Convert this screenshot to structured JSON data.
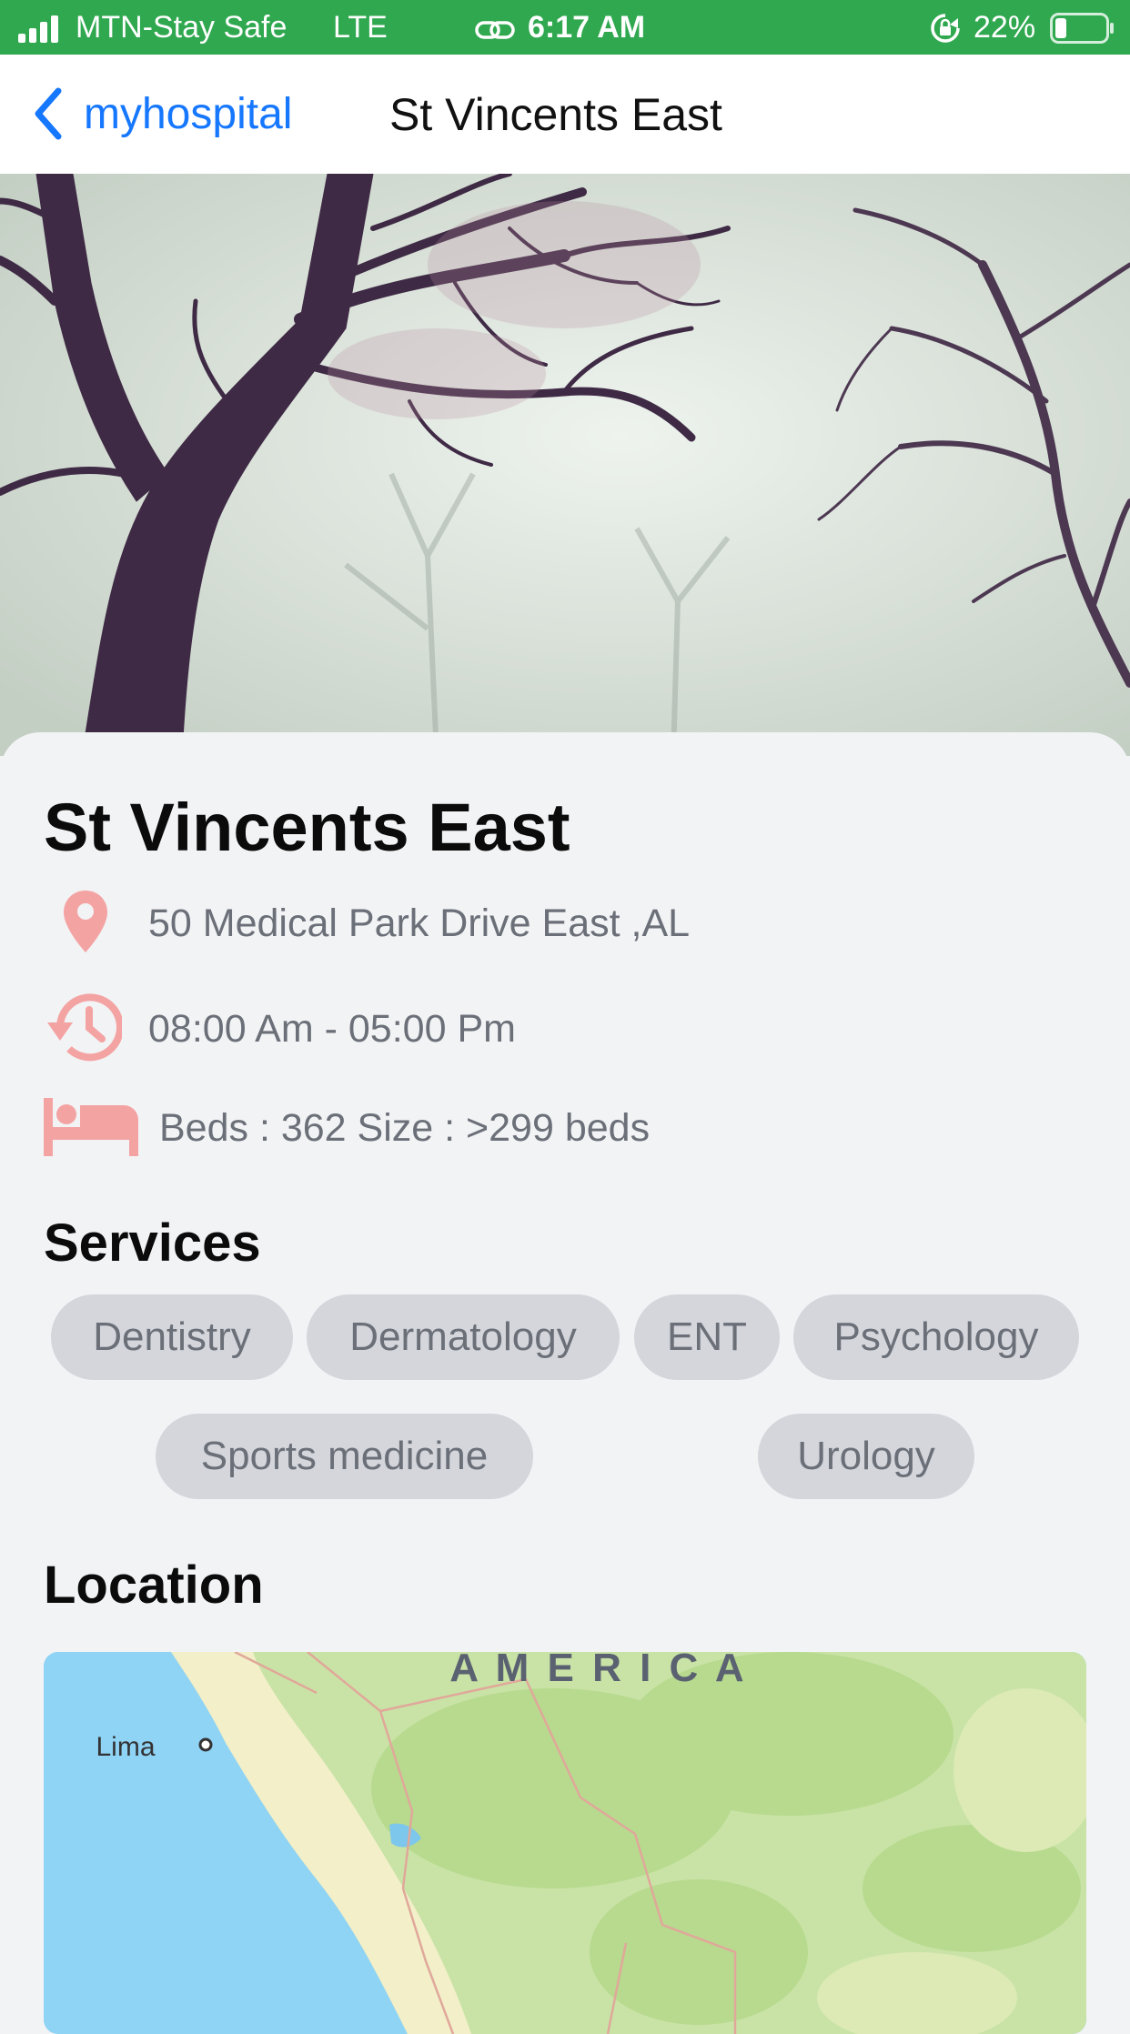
{
  "status_bar": {
    "carrier": "MTN-Stay Safe",
    "network": "LTE",
    "time": "6:17 AM",
    "battery": "22%"
  },
  "nav": {
    "back_label": "myhospital",
    "title": "St Vincents East"
  },
  "hospital": {
    "name": "St Vincents East",
    "address": "50 Medical Park Drive East ,AL",
    "hours": "08:00 Am - 05:00 Pm",
    "beds": "Beds : 362 Size : >299 beds"
  },
  "services": {
    "title": "Services",
    "items": [
      "Dentistry",
      "Dermatology",
      "ENT",
      "Psychology",
      "Sports medicine",
      "Urology"
    ]
  },
  "location": {
    "title": "Location",
    "map_labels": {
      "region": "A M E R I C A",
      "city": "Lima"
    }
  },
  "colors": {
    "status_bar": "#2fa84f",
    "accent_blue": "#1677ff",
    "icon_pink": "#f4a3a3",
    "chip_bg": "#d4d6dc"
  }
}
